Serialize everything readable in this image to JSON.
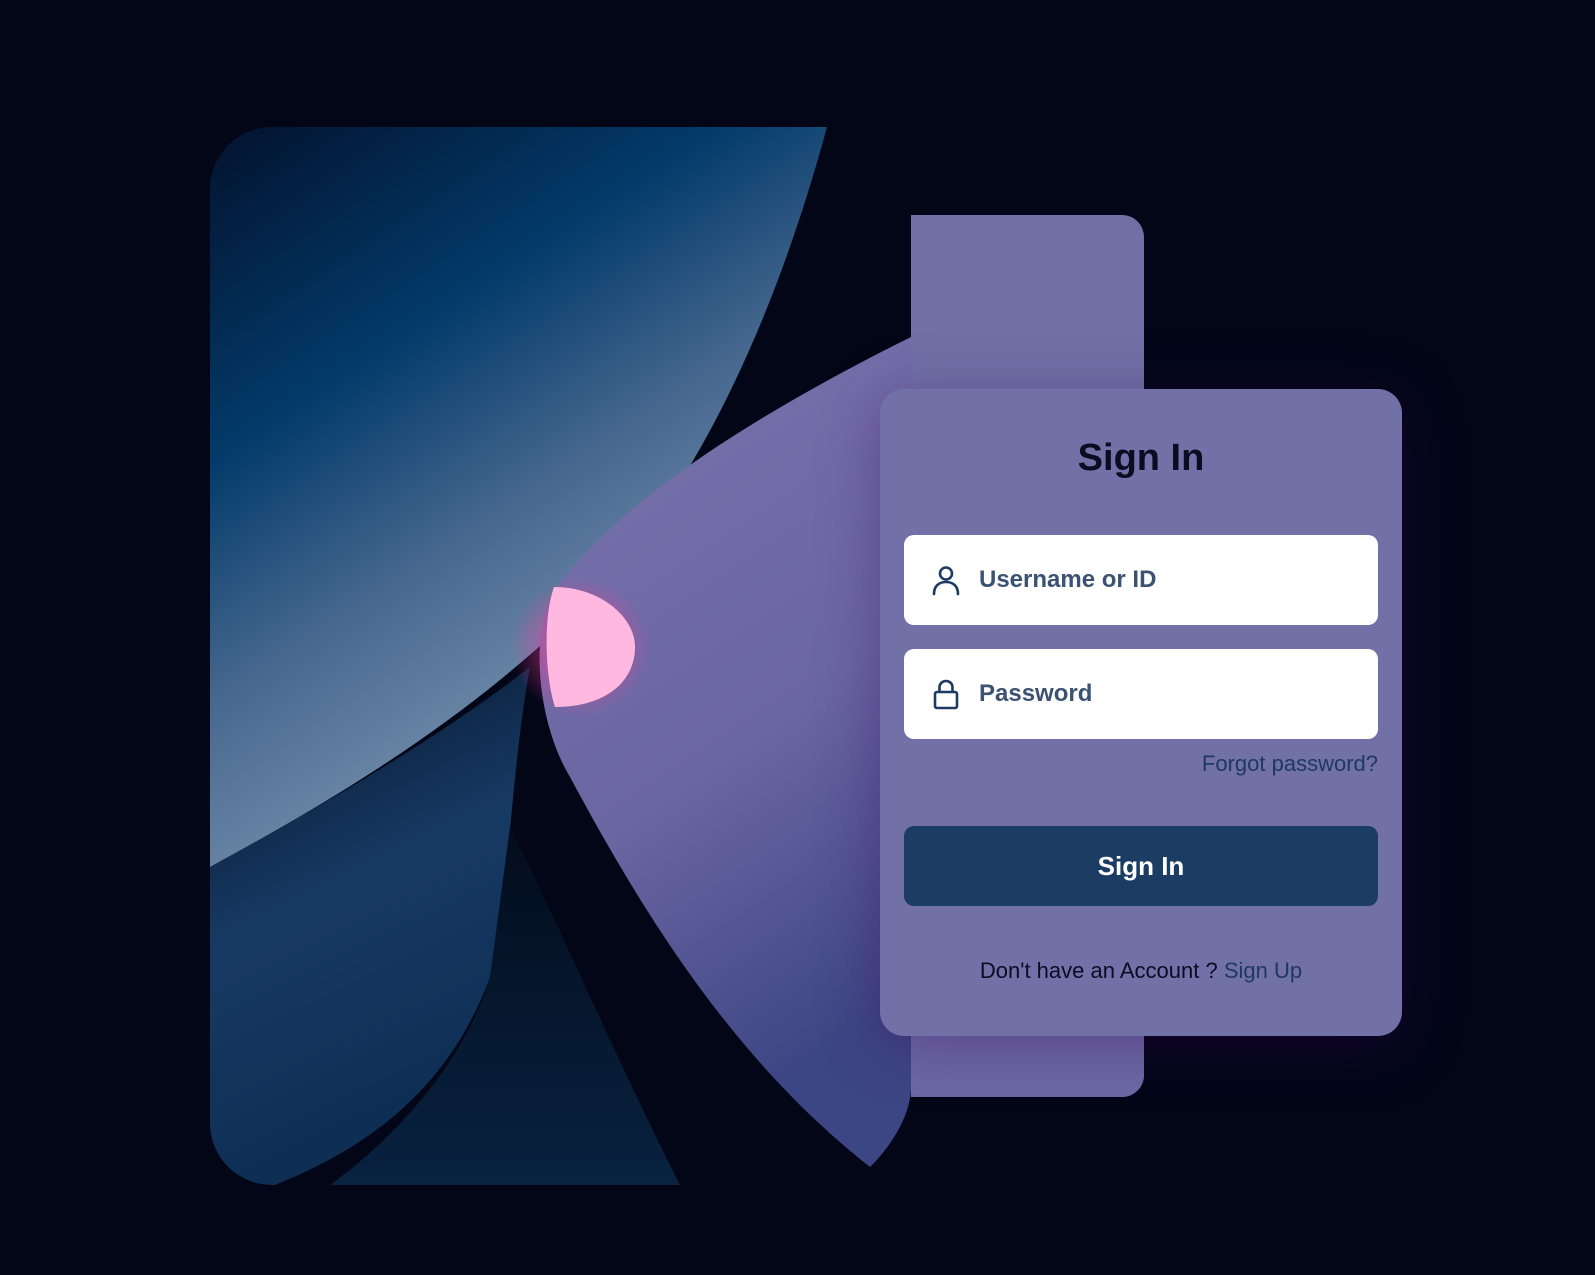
{
  "login": {
    "title": "Sign In",
    "username_placeholder": "Username or ID",
    "password_placeholder": "Password",
    "forgot_label": "Forgot password?",
    "submit_label": "Sign In",
    "footer_text": "Don't have an Account ?",
    "signup_label": "Sign Up"
  },
  "icons": {
    "user": "user-icon",
    "lock": "lock-icon"
  },
  "colors": {
    "background": "#020617",
    "card": "#7170a7",
    "button": "#1c3d63",
    "link": "#1e3a60",
    "accent_pink": "#ffb8df"
  }
}
